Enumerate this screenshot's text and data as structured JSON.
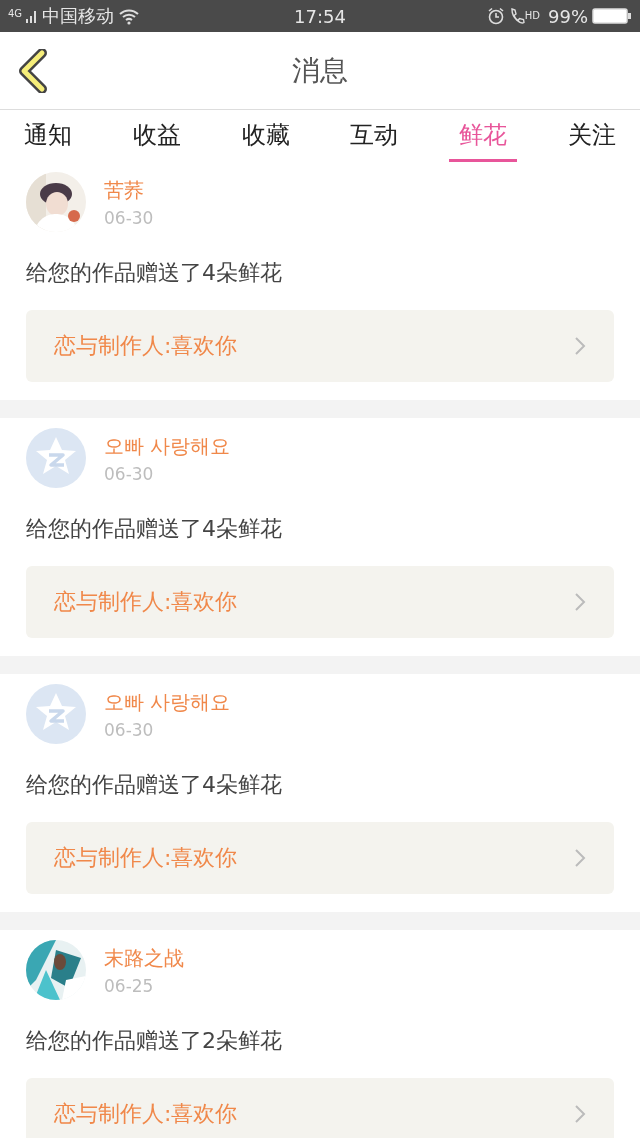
{
  "status_bar": {
    "network": "4G",
    "carrier": "中国移动",
    "time": "17:54",
    "call_badge": "HD",
    "battery": "99%"
  },
  "header": {
    "title": "消息"
  },
  "tabs": [
    {
      "label": "通知",
      "selected": false
    },
    {
      "label": "收益",
      "selected": false
    },
    {
      "label": "收藏",
      "selected": false
    },
    {
      "label": "互动",
      "selected": false
    },
    {
      "label": "鲜花",
      "selected": true
    },
    {
      "label": "关注",
      "selected": false
    }
  ],
  "messages": [
    {
      "name": "苦荞",
      "date": "06-30",
      "text": "给您的作品赠送了4朵鲜花",
      "work": "恋与制作人:喜欢你"
    },
    {
      "avatar": {
        "kind": "default"
      },
      "name": "오빠 사랑해요",
      "date": "06-30",
      "text": "给您的作品赠送了4朵鲜花",
      "work": "恋与制作人:喜欢你"
    },
    {
      "avatar": {
        "kind": "default"
      },
      "name": "오빠 사랑해요",
      "date": "06-30",
      "text": "给您的作品赠送了4朵鲜花",
      "work": "恋与制作人:喜欢你"
    },
    {
      "name": "末路之战",
      "date": "06-25",
      "text": "给您的作品赠送了2朵鲜花",
      "work": "恋与制作人:喜欢你"
    }
  ]
}
